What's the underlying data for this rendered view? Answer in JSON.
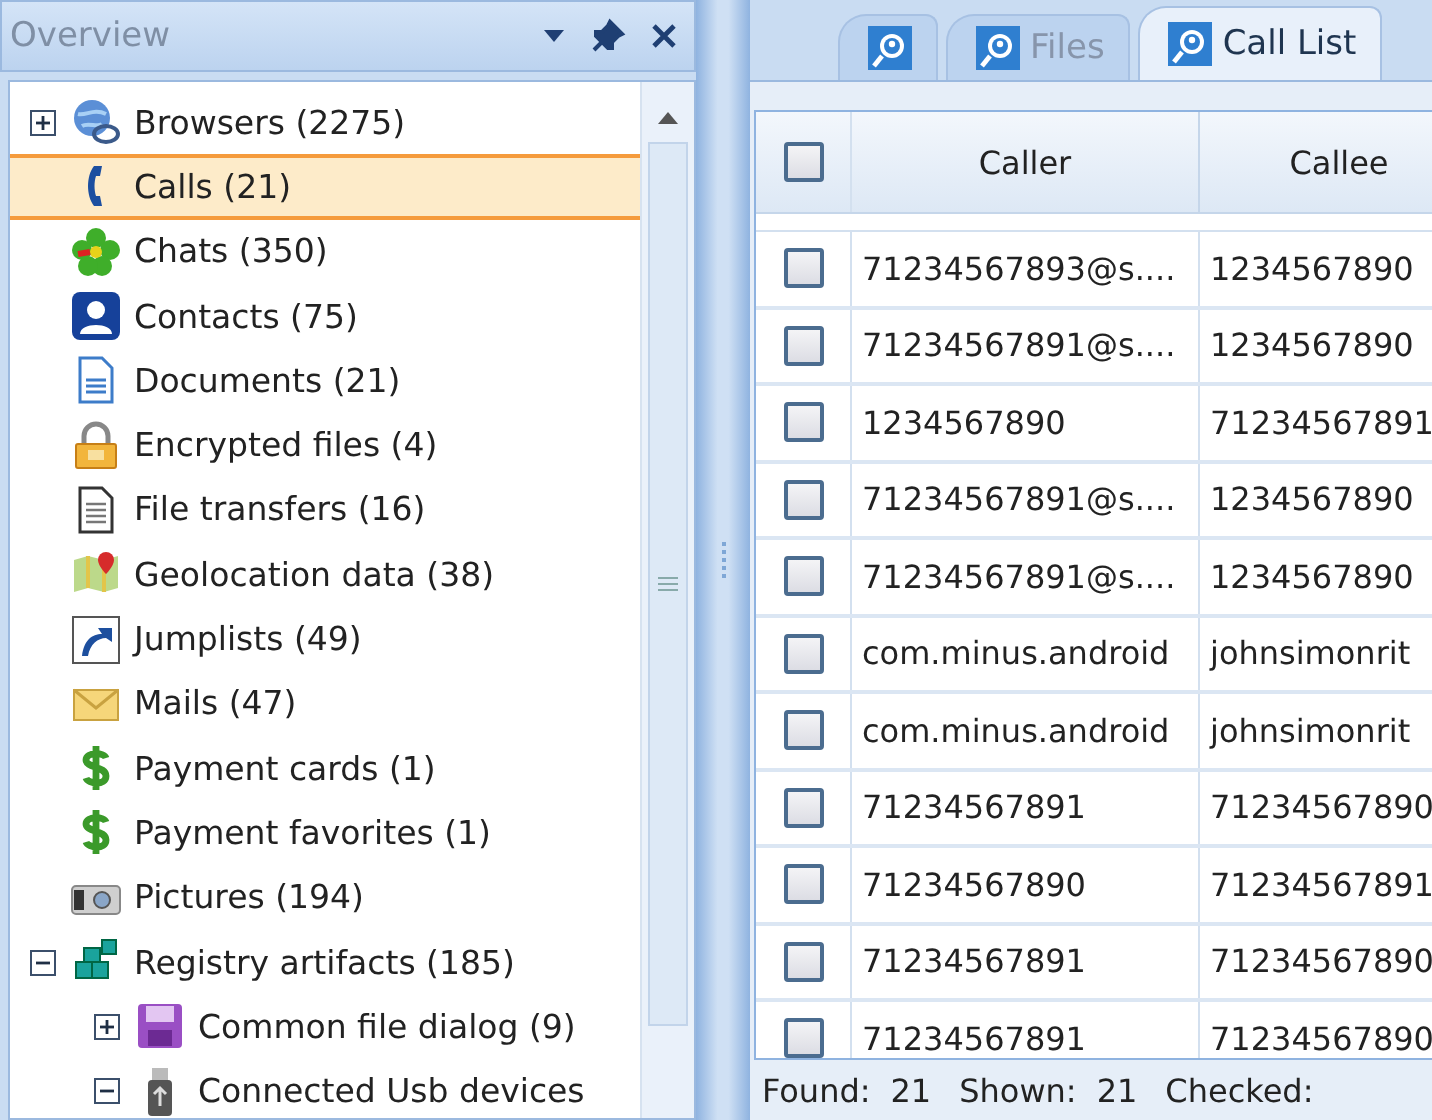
{
  "overview": {
    "title": "Overview",
    "items": [
      {
        "label": "Browsers (2275)",
        "selected": false,
        "expanded": false
      },
      {
        "label": "Calls (21)",
        "selected": true
      },
      {
        "label": "Chats (350)",
        "selected": false
      },
      {
        "label": "Contacts (75)",
        "selected": false
      },
      {
        "label": "Documents (21)",
        "selected": false
      },
      {
        "label": "Encrypted files (4)",
        "selected": false
      },
      {
        "label": "File transfers (16)",
        "selected": false
      },
      {
        "label": "Geolocation data (38)",
        "selected": false
      },
      {
        "label": "Jumplists (49)",
        "selected": false
      },
      {
        "label": "Mails (47)",
        "selected": false
      },
      {
        "label": "Payment cards (1)",
        "selected": false
      },
      {
        "label": "Payment favorites (1)",
        "selected": false
      },
      {
        "label": "Pictures (194)",
        "selected": false
      },
      {
        "label": "Registry artifacts (185)",
        "selected": false,
        "expanded": true,
        "children": [
          {
            "label": "Common file dialog (9)",
            "selected": false,
            "expanded": false
          },
          {
            "label": "Connected Usb devices",
            "selected": false,
            "expanded": true
          }
        ]
      }
    ]
  },
  "tabs": [
    {
      "selected": false
    },
    {
      "label": "Files",
      "selected": false
    },
    {
      "label": "Call List",
      "selected": true
    }
  ],
  "table": {
    "header_checked": false,
    "columns": [
      "Caller",
      "Callee"
    ],
    "rows": [
      {
        "checked": false,
        "cells": [
          "71234567893@s....",
          "1234567890"
        ]
      },
      {
        "checked": false,
        "cells": [
          "71234567891@s....",
          "1234567890"
        ]
      },
      {
        "checked": false,
        "cells": [
          "1234567890",
          "71234567891"
        ]
      },
      {
        "checked": false,
        "cells": [
          "71234567891@s....",
          "1234567890"
        ]
      },
      {
        "checked": false,
        "cells": [
          "71234567891@s....",
          "1234567890"
        ]
      },
      {
        "checked": false,
        "cells": [
          "com.minus.android",
          "johnsimonrit"
        ]
      },
      {
        "checked": false,
        "cells": [
          "com.minus.android",
          "johnsimonrit"
        ]
      },
      {
        "checked": false,
        "cells": [
          "71234567891",
          "71234567890"
        ]
      },
      {
        "checked": false,
        "cells": [
          "71234567890",
          "71234567891"
        ]
      },
      {
        "checked": false,
        "cells": [
          "71234567891",
          "71234567890"
        ]
      },
      {
        "checked": false,
        "cells": [
          "71234567891",
          "71234567890"
        ]
      }
    ]
  },
  "status_bar": [
    {
      "label": "Found:",
      "value": "21"
    },
    {
      "label": "Shown:",
      "value": "21"
    },
    {
      "label": "Checked:"
    }
  ]
}
